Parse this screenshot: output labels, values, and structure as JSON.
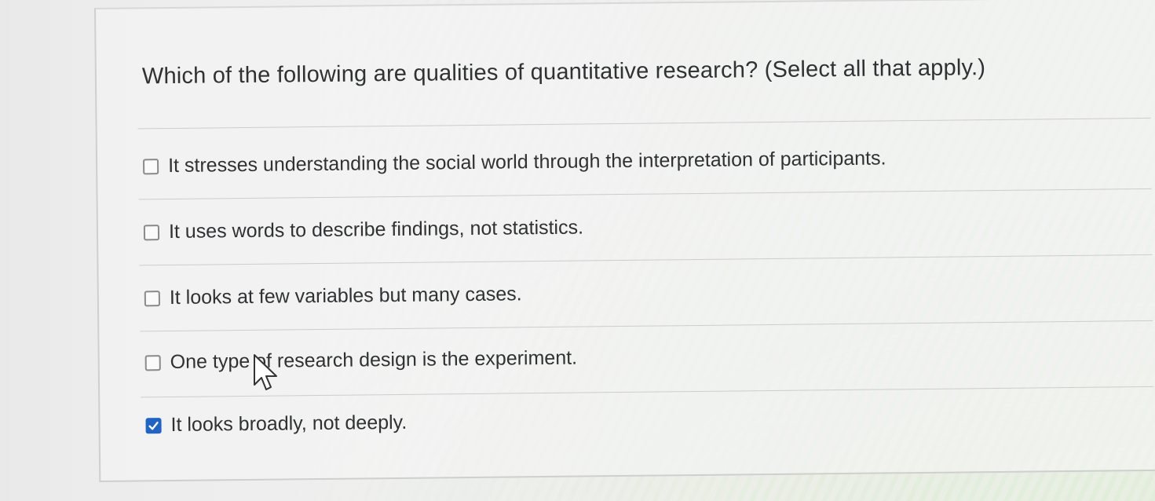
{
  "question": {
    "text": "Which of the following are qualities of quantitative research? (Select all that apply.)"
  },
  "options": [
    {
      "label": "It stresses understanding the social world through the interpretation of participants.",
      "checked": false
    },
    {
      "label": "It uses words to describe findings, not statistics.",
      "checked": false
    },
    {
      "label": "It looks at few variables but many cases.",
      "checked": false
    },
    {
      "label": "One type of research design is the experiment.",
      "checked": false
    },
    {
      "label": "It looks broadly, not deeply.",
      "checked": true
    }
  ],
  "colors": {
    "accent": "#1f63c6",
    "text": "#2f3133",
    "divider": "#cdcdcd"
  },
  "icons": {
    "cursor": "mouse-pointer-icon",
    "check": "checkmark-icon"
  }
}
